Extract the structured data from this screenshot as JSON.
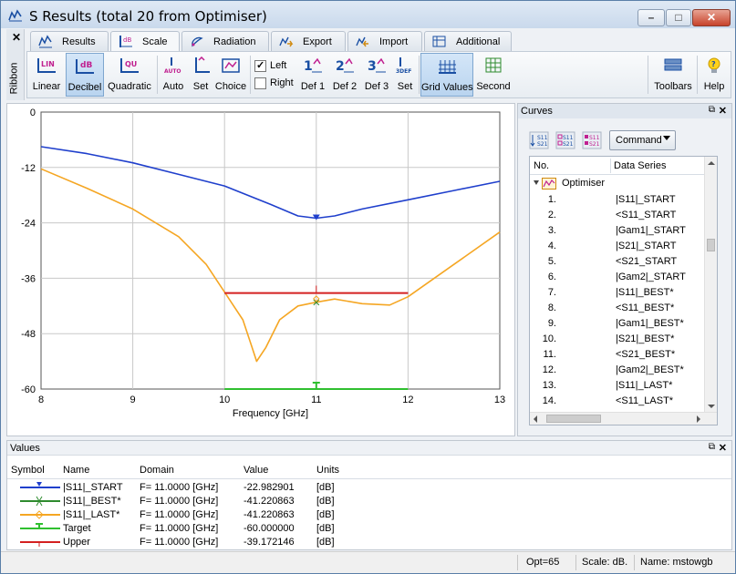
{
  "window": {
    "title": "S Results (total 20 from Optimiser)"
  },
  "ribbon": {
    "side_label": "Ribbon",
    "tabs": [
      {
        "label": "Results",
        "icon": "results-icon"
      },
      {
        "label": "Scale",
        "icon": "scale-icon"
      },
      {
        "label": "Radiation",
        "icon": "radiation-icon"
      },
      {
        "label": "Export",
        "icon": "export-icon"
      },
      {
        "label": "Import",
        "icon": "import-icon"
      },
      {
        "label": "Additional",
        "icon": "additional-icon"
      }
    ],
    "active_tab": "Scale",
    "buttons": {
      "linear": "Linear",
      "decibel": "Decibel",
      "quadratic": "Quadratic",
      "auto": "Auto",
      "set": "Set",
      "choice": "Choice",
      "left": "Left",
      "right": "Right",
      "def1": "Def 1",
      "def2": "Def 2",
      "def3": "Def 3",
      "set2": "Set",
      "grid_values": "Grid Values",
      "second": "Second",
      "toolbars": "Toolbars",
      "help": "Help"
    },
    "icon_text": {
      "lin": "LIN",
      "db": "dB",
      "qu": "QU",
      "auto": "AUTO",
      "d1": "1",
      "d2": "2",
      "d3": "3",
      "def": "3DEF"
    },
    "left_checked": true,
    "right_checked": false,
    "accent": "#1a4fa3"
  },
  "chart_data": {
    "type": "line",
    "xlabel": "Frequency [GHz]",
    "ylabel": "",
    "xlim": [
      8,
      13
    ],
    "ylim": [
      -60,
      0
    ],
    "x_ticks": [
      "8",
      "9",
      "10",
      "11",
      "12",
      "13"
    ],
    "y_ticks": [
      "0",
      "-12",
      "-24",
      "-36",
      "-48",
      "-60"
    ],
    "grid": true,
    "cursor_x": 11,
    "series": [
      {
        "name": "|S11|_START",
        "color": "#1f3fcc",
        "x": [
          8,
          8.5,
          9,
          9.5,
          10,
          10.5,
          10.8,
          11,
          11.2,
          11.5,
          12,
          12.5,
          13
        ],
        "y": [
          -7.5,
          -9,
          -11,
          -13.5,
          -16,
          -20,
          -22.5,
          -23,
          -22.5,
          -21,
          -19,
          -17,
          -15
        ]
      },
      {
        "name": "|S11|_LAST*",
        "color": "#f5a623",
        "x": [
          8,
          8.5,
          9,
          9.5,
          9.8,
          10,
          10.2,
          10.3,
          10.35,
          10.45,
          10.6,
          10.8,
          11,
          11.2,
          11.5,
          11.8,
          12,
          12.5,
          13
        ],
        "y": [
          -12.3,
          -16.5,
          -21,
          -27,
          -33,
          -39,
          -45,
          -51,
          -54,
          -51,
          -45,
          -42,
          -41.2,
          -40.5,
          -41.5,
          -41.8,
          -40,
          -33,
          -26
        ]
      },
      {
        "name": "Upper",
        "color": "#d42020",
        "x": [
          10,
          12
        ],
        "y": [
          -39.2,
          -39.2
        ]
      },
      {
        "name": "Target",
        "color": "#2fbf2f",
        "x": [
          10,
          12
        ],
        "y": [
          -60,
          -60
        ]
      }
    ]
  },
  "curves": {
    "title": "Curves",
    "command_label": "Command",
    "col_no": "No.",
    "col_series": "Data Series",
    "group": "Optimiser",
    "rows": [
      {
        "no": "1.",
        "name": "|S11|_START"
      },
      {
        "no": "2.",
        "name": "<S11_START"
      },
      {
        "no": "3.",
        "name": "|Gam1|_START"
      },
      {
        "no": "4.",
        "name": "|S21|_START"
      },
      {
        "no": "5.",
        "name": "<S21_START"
      },
      {
        "no": "6.",
        "name": "|Gam2|_START"
      },
      {
        "no": "7.",
        "name": "|S11|_BEST*"
      },
      {
        "no": "8.",
        "name": "<S11_BEST*"
      },
      {
        "no": "9.",
        "name": "|Gam1|_BEST*"
      },
      {
        "no": "10.",
        "name": "|S21|_BEST*"
      },
      {
        "no": "11.",
        "name": "<S21_BEST*"
      },
      {
        "no": "12.",
        "name": "|Gam2|_BEST*"
      },
      {
        "no": "13.",
        "name": "|S11|_LAST*"
      },
      {
        "no": "14.",
        "name": "<S11_LAST*"
      }
    ],
    "icon_text": [
      "S11/S21",
      "S11/S21",
      "S11/S21"
    ]
  },
  "values": {
    "title": "Values",
    "headers": {
      "symbol": "Symbol",
      "name": "Name",
      "domain": "Domain",
      "value": "Value",
      "units": "Units"
    },
    "rows": [
      {
        "name": "|S11|_START",
        "domain": "F= 11.0000 [GHz]",
        "value": "-22.982901",
        "units": "[dB]",
        "color": "#1f3fcc",
        "marker": "tri-down"
      },
      {
        "name": "|S11|_BEST*",
        "domain": "F= 11.0000 [GHz]",
        "value": "-41.220863",
        "units": "[dB]",
        "color": "#2e8b2e",
        "marker": "x"
      },
      {
        "name": "|S11|_LAST*",
        "domain": "F= 11.0000 [GHz]",
        "value": "-41.220863",
        "units": "[dB]",
        "color": "#f5a623",
        "marker": "diamond"
      },
      {
        "name": "Target",
        "domain": "F= 11.0000 [GHz]",
        "value": "-60.000000",
        "units": "[dB]",
        "color": "#2fbf2f",
        "marker": "t"
      },
      {
        "name": "Upper",
        "domain": "F= 11.0000 [GHz]",
        "value": "-39.172146",
        "units": "[dB]",
        "color": "#d42020",
        "marker": "bar"
      }
    ]
  },
  "status": {
    "opt": "Opt=65",
    "scale": "Scale: dB.",
    "name": "Name: mstowgb"
  }
}
